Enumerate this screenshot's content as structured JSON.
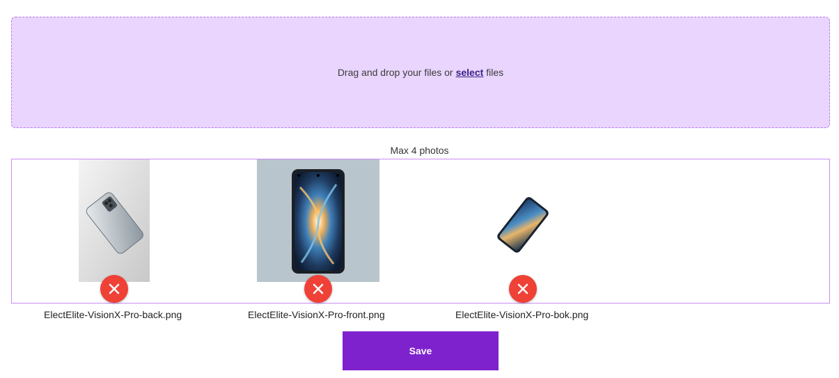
{
  "dropzone": {
    "text_before": "Drag and drop your files or",
    "link": "select",
    "text_after": "files"
  },
  "max_label": "Max 4 photos",
  "photos": [
    {
      "filename": "ElectElite-VisionX-Pro-back.png",
      "icon": "phone-back-photo"
    },
    {
      "filename": "ElectElite-VisionX-Pro-front.png",
      "icon": "phone-front-photo"
    },
    {
      "filename": "ElectElite-VisionX-Pro-bok.png",
      "icon": "phone-side-photo"
    }
  ],
  "save_label": "Save",
  "colors": {
    "accent": "#7e22ce",
    "dropzone_bg": "#e9d5fd",
    "remove": "#ef4136"
  }
}
